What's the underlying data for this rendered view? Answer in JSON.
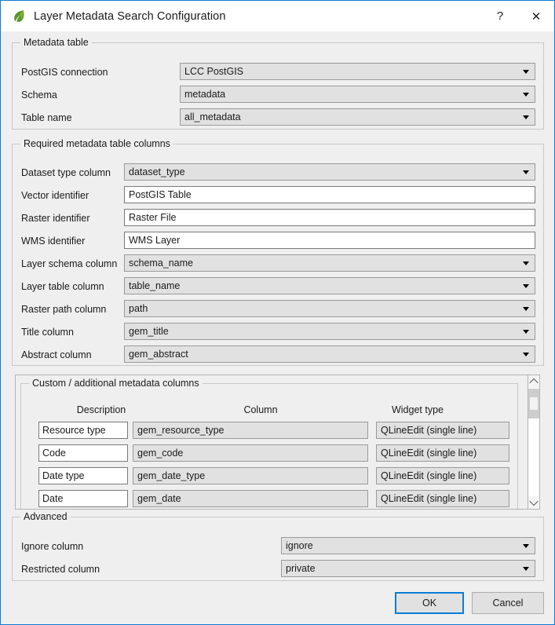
{
  "window": {
    "title": "Layer Metadata Search Configuration",
    "icon": "qgis-leaf-icon",
    "help_label": "?",
    "close_label": "✕",
    "accent_color": "#0c7cd5"
  },
  "metadata_table": {
    "legend": "Metadata table",
    "rows": [
      {
        "label": "PostGIS connection",
        "value": "LCC PostGIS",
        "type": "combo"
      },
      {
        "label": "Schema",
        "value": "metadata",
        "type": "combo"
      },
      {
        "label": "Table name",
        "value": "all_metadata",
        "type": "combo"
      }
    ]
  },
  "required_columns": {
    "legend": "Required metadata table columns",
    "rows": [
      {
        "label": "Dataset type column",
        "value": "dataset_type",
        "type": "combo"
      },
      {
        "label": "Vector identifier",
        "value": "PostGIS Table",
        "type": "lineedit"
      },
      {
        "label": "Raster identifier",
        "value": "Raster File",
        "type": "lineedit"
      },
      {
        "label": "WMS identifier",
        "value": "WMS Layer",
        "type": "lineedit"
      },
      {
        "label": "Layer schema column",
        "value": "schema_name",
        "type": "combo"
      },
      {
        "label": "Layer table column",
        "value": "table_name",
        "type": "combo"
      },
      {
        "label": "Raster path column",
        "value": "path",
        "type": "combo"
      },
      {
        "label": "Title column",
        "value": "gem_title",
        "type": "combo"
      },
      {
        "label": "Abstract column",
        "value": "gem_abstract",
        "type": "combo"
      }
    ]
  },
  "custom_columns": {
    "legend": "Custom / additional metadata columns",
    "headers": [
      "Description",
      "Column",
      "Widget type"
    ],
    "rows": [
      {
        "description": "Resource type",
        "column": "gem_resource_type",
        "widget": "QLineEdit (single line)"
      },
      {
        "description": "Code",
        "column": "gem_code",
        "widget": "QLineEdit (single line)"
      },
      {
        "description": "Date type",
        "column": "gem_date_type",
        "widget": "QLineEdit (single line)"
      },
      {
        "description": "Date",
        "column": "gem_date",
        "widget": "QLineEdit (single line)"
      }
    ],
    "scrollbar": {
      "up_icon": "chevron-up-icon",
      "down_icon": "chevron-down-icon"
    }
  },
  "advanced": {
    "legend": "Advanced",
    "rows": [
      {
        "label": "Ignore column",
        "value": "ignore",
        "type": "combo"
      },
      {
        "label": "Restricted column",
        "value": "private",
        "type": "combo"
      }
    ]
  },
  "buttons": {
    "ok": "OK",
    "cancel": "Cancel"
  }
}
